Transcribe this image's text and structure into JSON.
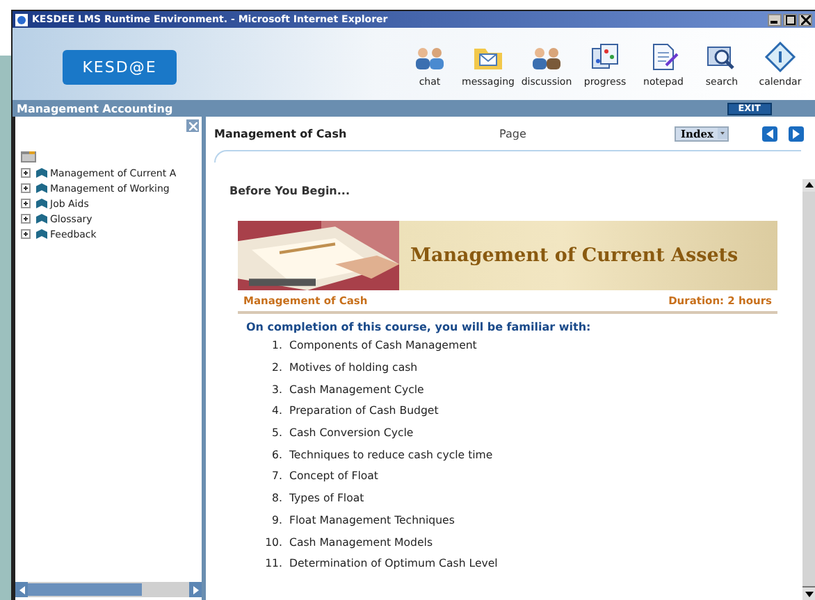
{
  "window": {
    "title": "KESDEE LMS Runtime Environment. - Microsoft Internet Explorer"
  },
  "logo": "KESD@E",
  "toolbar": [
    {
      "label": "chat"
    },
    {
      "label": "messaging"
    },
    {
      "label": "discussion"
    },
    {
      "label": "progress"
    },
    {
      "label": "notepad"
    },
    {
      "label": "search"
    },
    {
      "label": "calendar"
    }
  ],
  "course_bar": {
    "title": "Management Accounting",
    "exit": "EXIT"
  },
  "tree": [
    {
      "label": "Management of Current A",
      "expanded": false
    },
    {
      "label": "Management of Working",
      "expanded": false
    },
    {
      "label": "Job Aids",
      "expanded": false
    },
    {
      "label": "Glossary",
      "expanded": false
    },
    {
      "label": "Feedback",
      "expanded": false
    }
  ],
  "content": {
    "title": "Management of Cash",
    "page": "Page",
    "index": "Index",
    "heading": "Before You Begin...",
    "banner_title": "Management of Current Assets",
    "module": "Management of Cash",
    "duration": "Duration: 2 hours",
    "intro": "On completion of this course, you will be familiar with:",
    "items": [
      {
        "number": "1.",
        "text": "Components of Cash Management"
      },
      {
        "number": "2.",
        "text": "Motives of holding cash"
      },
      {
        "number": "3.",
        "text": "Cash Management Cycle"
      },
      {
        "number": "4.",
        "text": "Preparation of Cash Budget"
      },
      {
        "number": "5.",
        "text": "Cash Conversion Cycle"
      },
      {
        "number": "6.",
        "text": "Techniques to reduce cash cycle time"
      },
      {
        "number": "7.",
        "text": "Concept of Float"
      },
      {
        "number": "8.",
        "text": "Types of Float"
      },
      {
        "number": "9.",
        "text": "Float Management Techniques"
      },
      {
        "number": "10.",
        "text": "Cash Management Models"
      },
      {
        "number": "11.",
        "text": "Determination of Optimum Cash Level"
      }
    ]
  }
}
